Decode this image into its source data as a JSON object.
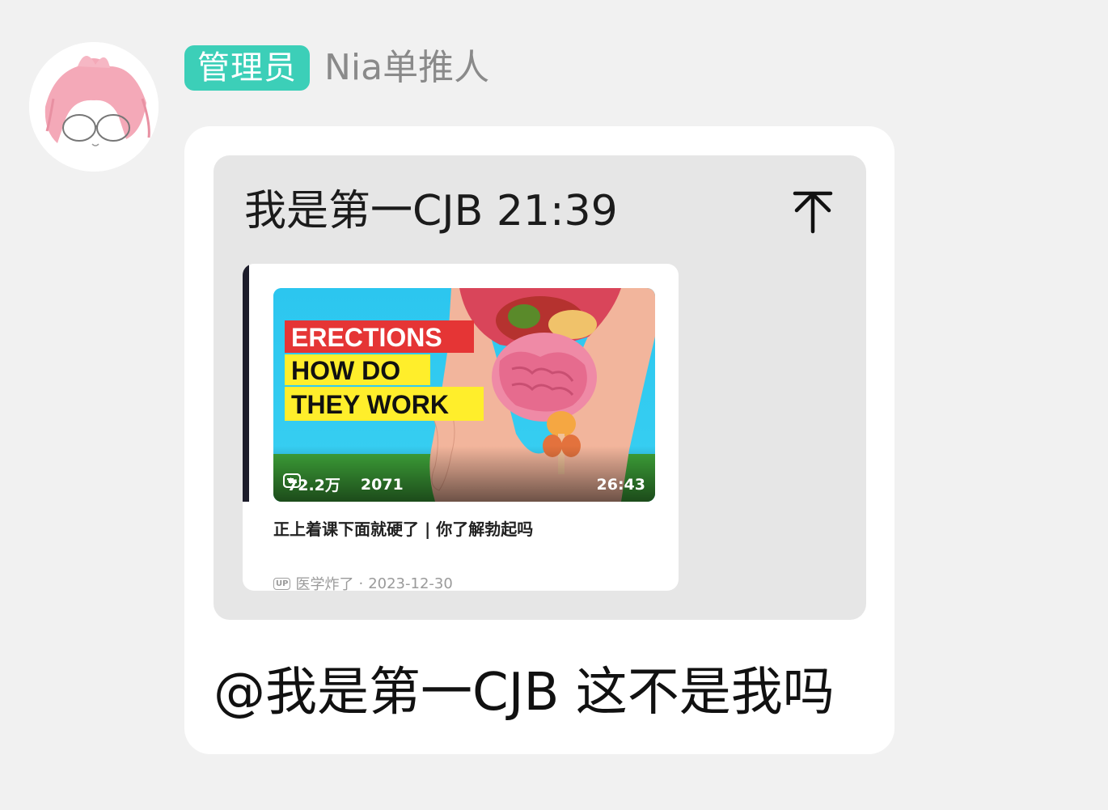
{
  "sender": {
    "role_badge": "管理员",
    "name": "Nia单推人",
    "badge_color": "#3ccfb8"
  },
  "quoted": {
    "header": "我是第一CJB 21:39",
    "action_icon": "scroll-to-top-icon",
    "video": {
      "thumbnail_lines": [
        "ERECTIONS",
        "HOW DO",
        "THEY WORK"
      ],
      "views": "72.2万",
      "comments": "2071",
      "duration": "26:43",
      "title": "正上着课下面就硬了 | 你了解勃起吗",
      "up_tag": "UP",
      "uploader": "医学炸了",
      "separator": "·",
      "date": "2023-12-30"
    }
  },
  "message": {
    "text": "@我是第一CJB 这不是我吗"
  }
}
